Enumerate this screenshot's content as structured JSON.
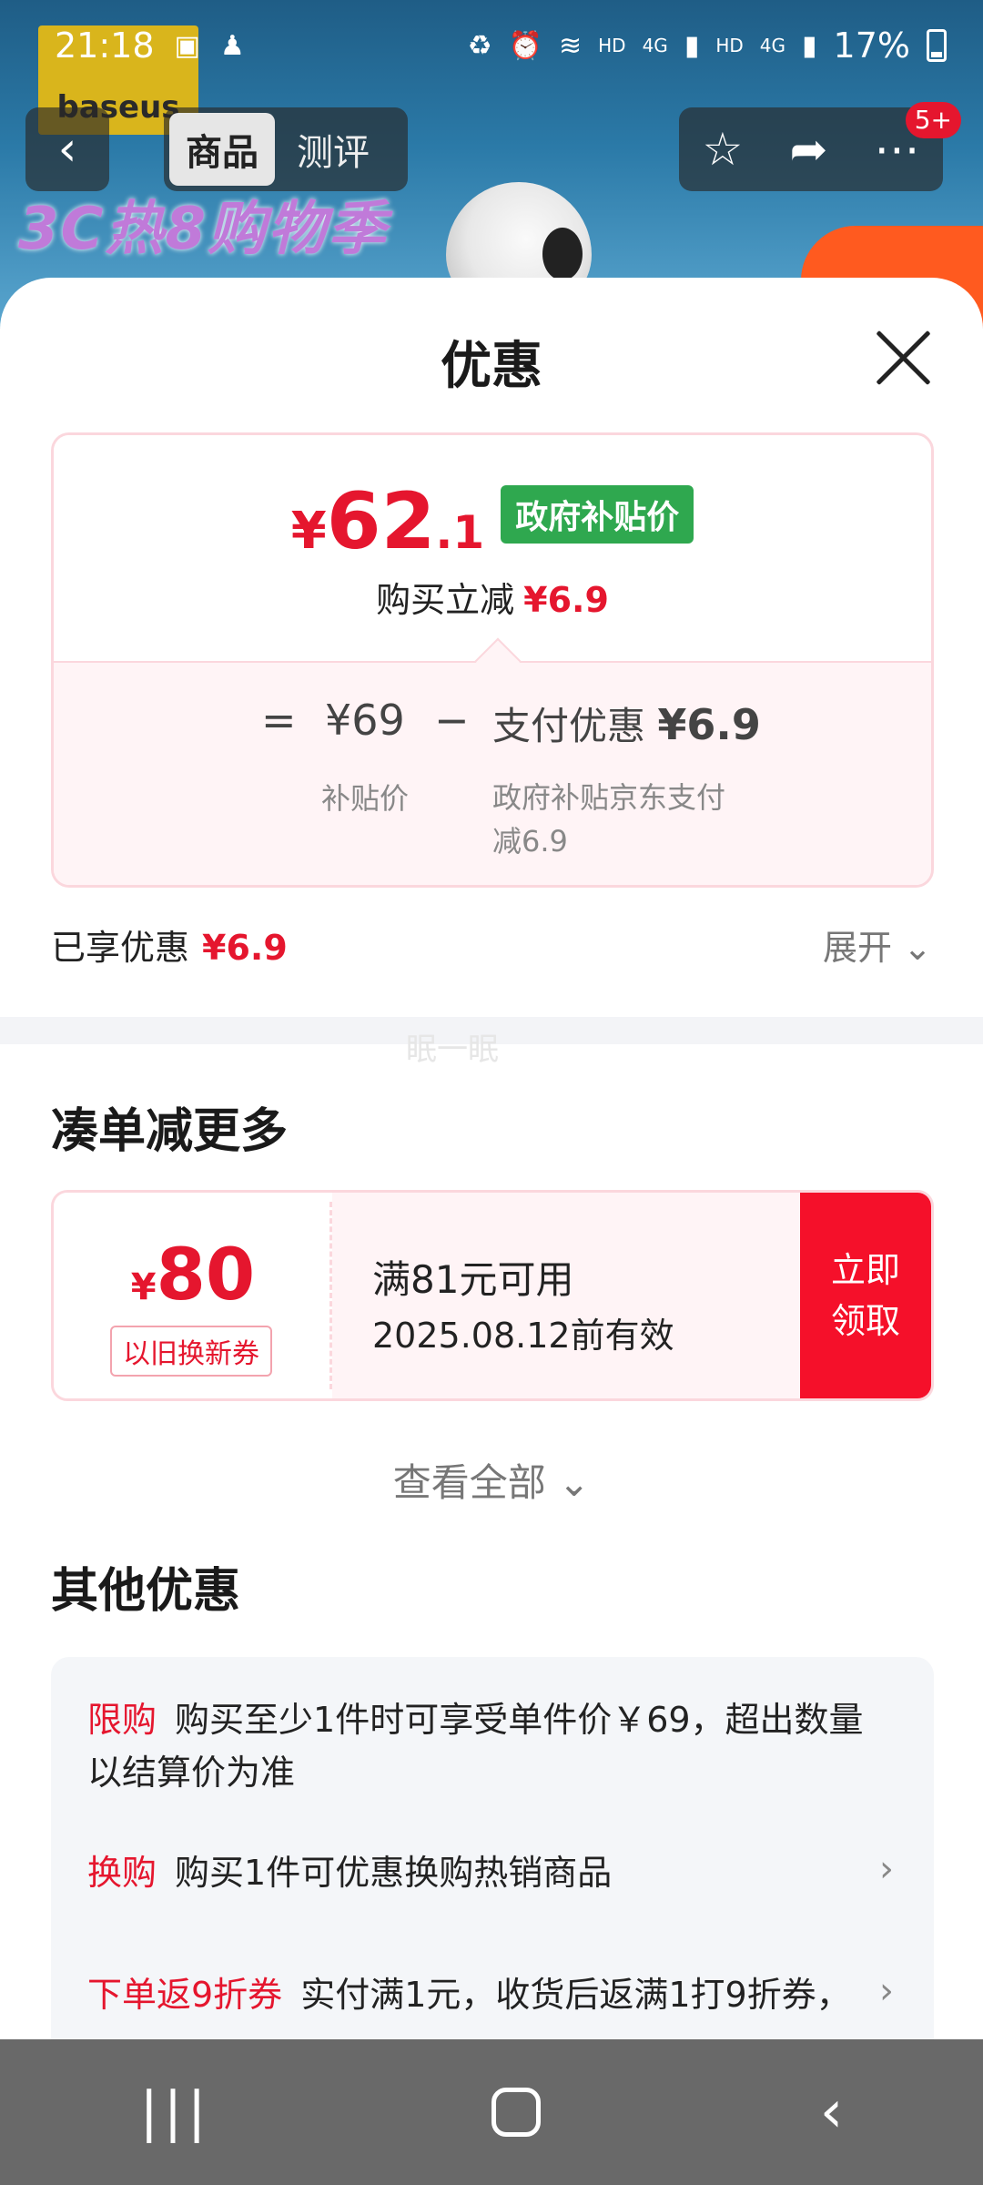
{
  "status_bar": {
    "time": "21:18",
    "right_text_1": "HD",
    "net_1": "4G",
    "right_text_2": "HD",
    "net_2": "4G",
    "battery": "17%"
  },
  "header": {
    "logo_text": "baseus",
    "tabs": [
      {
        "label": "商品"
      },
      {
        "label": "测评"
      }
    ],
    "badge": "5+",
    "banner": "3C热8购物季"
  },
  "sheet": {
    "title": "优惠",
    "price": {
      "currency": "¥",
      "int": "62",
      "dec": ".1",
      "tag": "政府补贴价"
    },
    "sub": {
      "label": "购买立减",
      "value": "¥6.9"
    },
    "breakdown": {
      "eq": "=",
      "value": "¥69",
      "minus": "−",
      "pay_label": "支付优惠",
      "pay_value": "¥6.9",
      "value_caption": "补贴价",
      "pay_caption": "政府补贴京东支付减6.9"
    },
    "enjoyed": {
      "label": "已享优惠",
      "value": "¥6.9"
    },
    "expand_label": "展开",
    "watermark": "眠一眠",
    "more_title": "凑单减更多",
    "coupon": {
      "yen": "¥",
      "amount": "80",
      "type": "以旧换新券",
      "condition": "满81元可用",
      "validity": "2025.08.12前有效",
      "button_line1": "立即",
      "button_line2": "领取"
    },
    "view_all": "查看全部",
    "other_title": "其他优惠",
    "promos": [
      {
        "tag": "限购",
        "text": "购买至少1件时可享受单件价￥69，超出数量以结算价为准"
      },
      {
        "tag": "换购",
        "text": "购买1件可优惠换购热销商品"
      },
      {
        "tag": "下单返9折券",
        "text": "实付满1元，收货后返满1打9折券，"
      }
    ]
  },
  "colors": {
    "accent": "#e5162e",
    "gov_tag": "#2fa84f",
    "coupon_btn": "#f5102a"
  }
}
